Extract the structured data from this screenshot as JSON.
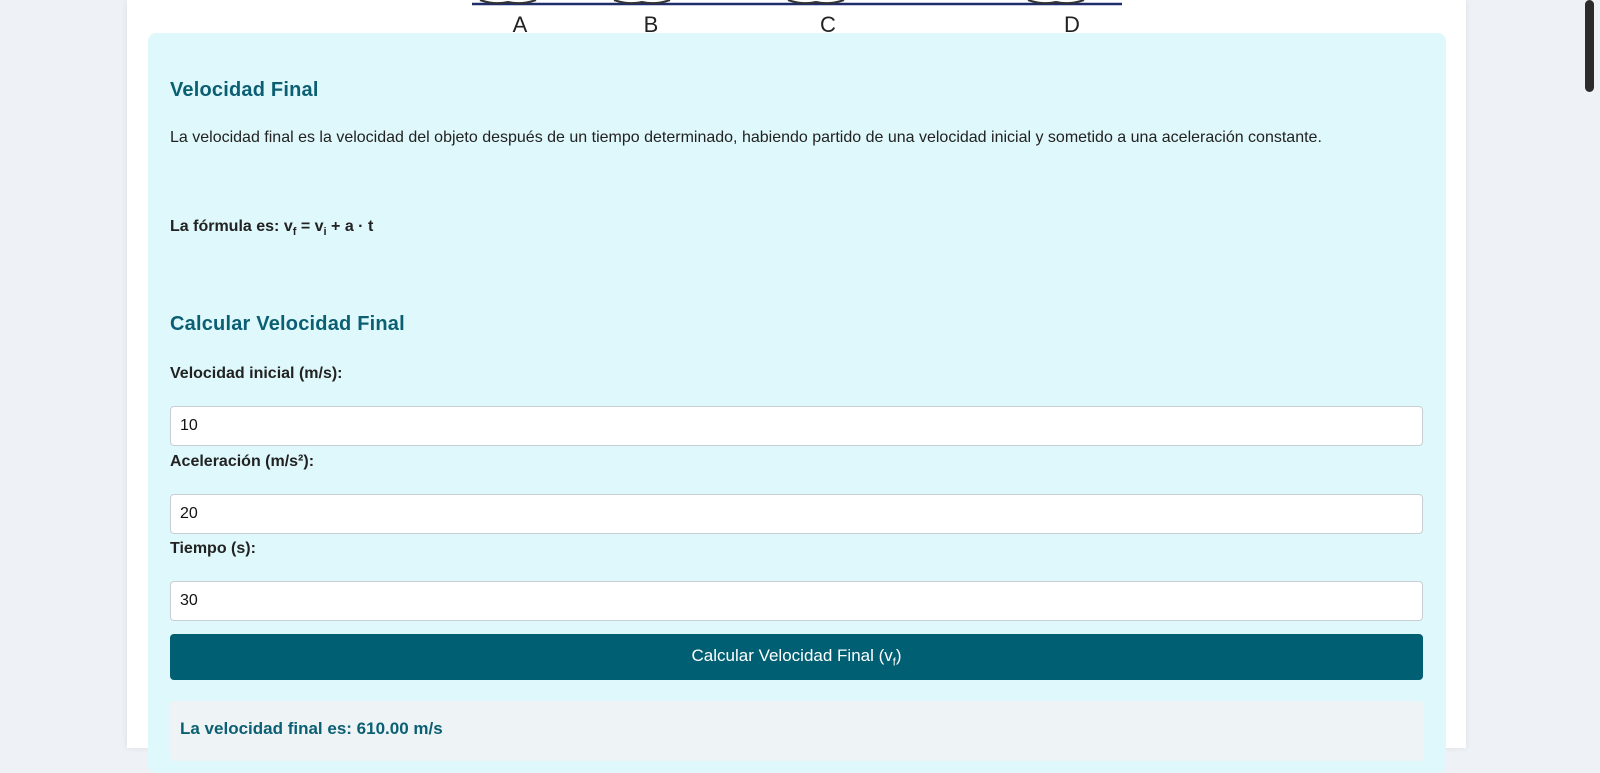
{
  "figure": {
    "points": [
      "A",
      "B",
      "C",
      "D"
    ],
    "line_color": "#1f2d6b"
  },
  "section": {
    "title": "Velocidad Final",
    "description": "La velocidad final es la velocidad del objeto después de un tiempo determinado, habiendo partido de una velocidad inicial y sometido a una aceleración constante.",
    "formula_prefix": "La fórmula es: ",
    "formula_vf": "v",
    "formula_vf_sub": "f",
    "formula_eq": " = v",
    "formula_vi_sub": "i",
    "formula_rest": " + a · t"
  },
  "calculator": {
    "title": "Calcular Velocidad Final",
    "initial_velocity_label": "Velocidad inicial (m/s):",
    "initial_velocity_value": "10",
    "acceleration_label": "Aceleración (m/s²):",
    "acceleration_value": "20",
    "time_label": "Tiempo (s):",
    "time_value": "30",
    "button_label": "Calcular Velocidad Final (v",
    "button_sub": "f",
    "button_close": ")",
    "result": "La velocidad final es: 610.00 m/s"
  },
  "colors": {
    "accent": "#005f73",
    "panel_bg": "#dff8fb",
    "heading": "#0b5f73"
  }
}
